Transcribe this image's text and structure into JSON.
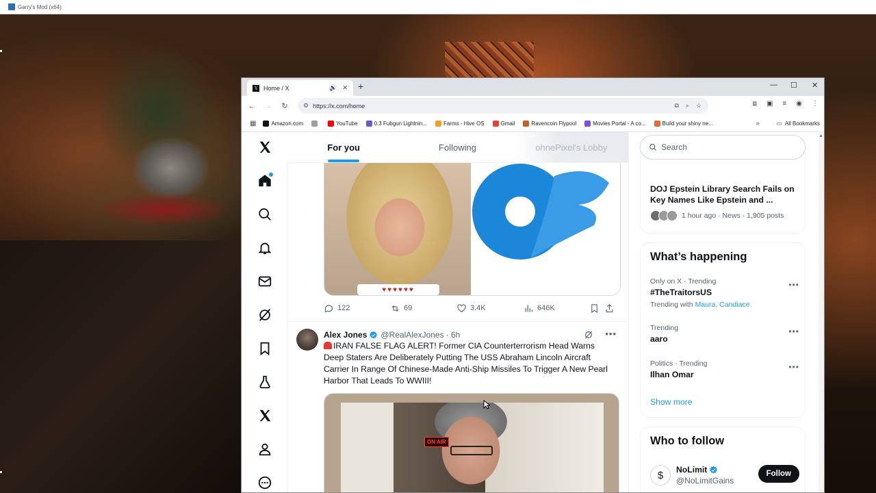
{
  "game_window": {
    "title": "Garry's Mod (x64)"
  },
  "browser": {
    "tab": {
      "title": "Home / X",
      "favicon": "x-logo"
    },
    "url": "https://x.com/home",
    "bookmarks": [
      {
        "label": "Amazon.com",
        "color": "#111111"
      },
      {
        "label": "",
        "color": "#9e9e9e"
      },
      {
        "label": "YouTube",
        "color": "#ff0000"
      },
      {
        "label": "0.3 Fubgun Lightnin...",
        "color": "#6a5acd"
      },
      {
        "label": "Farms - Hive OS",
        "color": "#f4a023"
      },
      {
        "label": "Gmail",
        "color": "#ea4335"
      },
      {
        "label": "Ravencoin Flypool",
        "color": "#c0612b"
      },
      {
        "label": "Movies Portal - A co...",
        "color": "#7b4ee0"
      },
      {
        "label": "Build your shiny ne...",
        "color": "#e06c3a"
      }
    ],
    "all_bookmarks": "All Bookmarks"
  },
  "feed": {
    "tabs": [
      {
        "label": "For you",
        "active": true
      },
      {
        "label": "Following",
        "active": false
      },
      {
        "label": "ohnePixel's Lobby",
        "active": false
      }
    ],
    "prev_tweet_actions": {
      "replies": "122",
      "reposts": "69",
      "likes": "3.4K",
      "views": "646K"
    },
    "prev_tweet_media": {
      "emoji_strip": "♥♥♥♥♥♥"
    },
    "tweet": {
      "name": "Alex Jones",
      "handle": "@RealAlexJones",
      "time": "· 6h",
      "text": "IRAN FALSE FLAG ALERT! Former CIA Counterterrorism Head Warns Deep Staters Are Deliberately Putting The USS Abraham Lincoln Aircraft Carrier In Range Of Chinese-Made Anti-Ship Missiles To Trigger A New Pearl Harbor That Leads To WWIII!",
      "video_sign": "ON AIR"
    }
  },
  "sidebar": {
    "search_placeholder": "Search",
    "news": {
      "title": "DOJ Epstein Library Search Fails on Key Names Like Epstein and ...",
      "meta": "1 hour ago · News · 1,905 posts"
    },
    "whats_happening": {
      "heading": "What’s happening",
      "trends": [
        {
          "context": "Only on X · Trending",
          "name": "#TheTraitorsUS",
          "with_prefix": "Trending with",
          "with_links": "Maura, Candiace"
        },
        {
          "context": "Trending",
          "name": "aaro"
        },
        {
          "context": "Politics · Trending",
          "name": "Ilhan Omar"
        }
      ],
      "show_more": "Show more"
    },
    "who_to_follow": {
      "heading": "Who to follow",
      "users": [
        {
          "name": "NoLimit",
          "handle": "@NoLimitGains",
          "avatar_glyph": "$",
          "button": "Follow"
        }
      ]
    }
  },
  "colors": {
    "accent": "#1d9bf0",
    "text": "#0f1419",
    "secondary": "#536471"
  }
}
